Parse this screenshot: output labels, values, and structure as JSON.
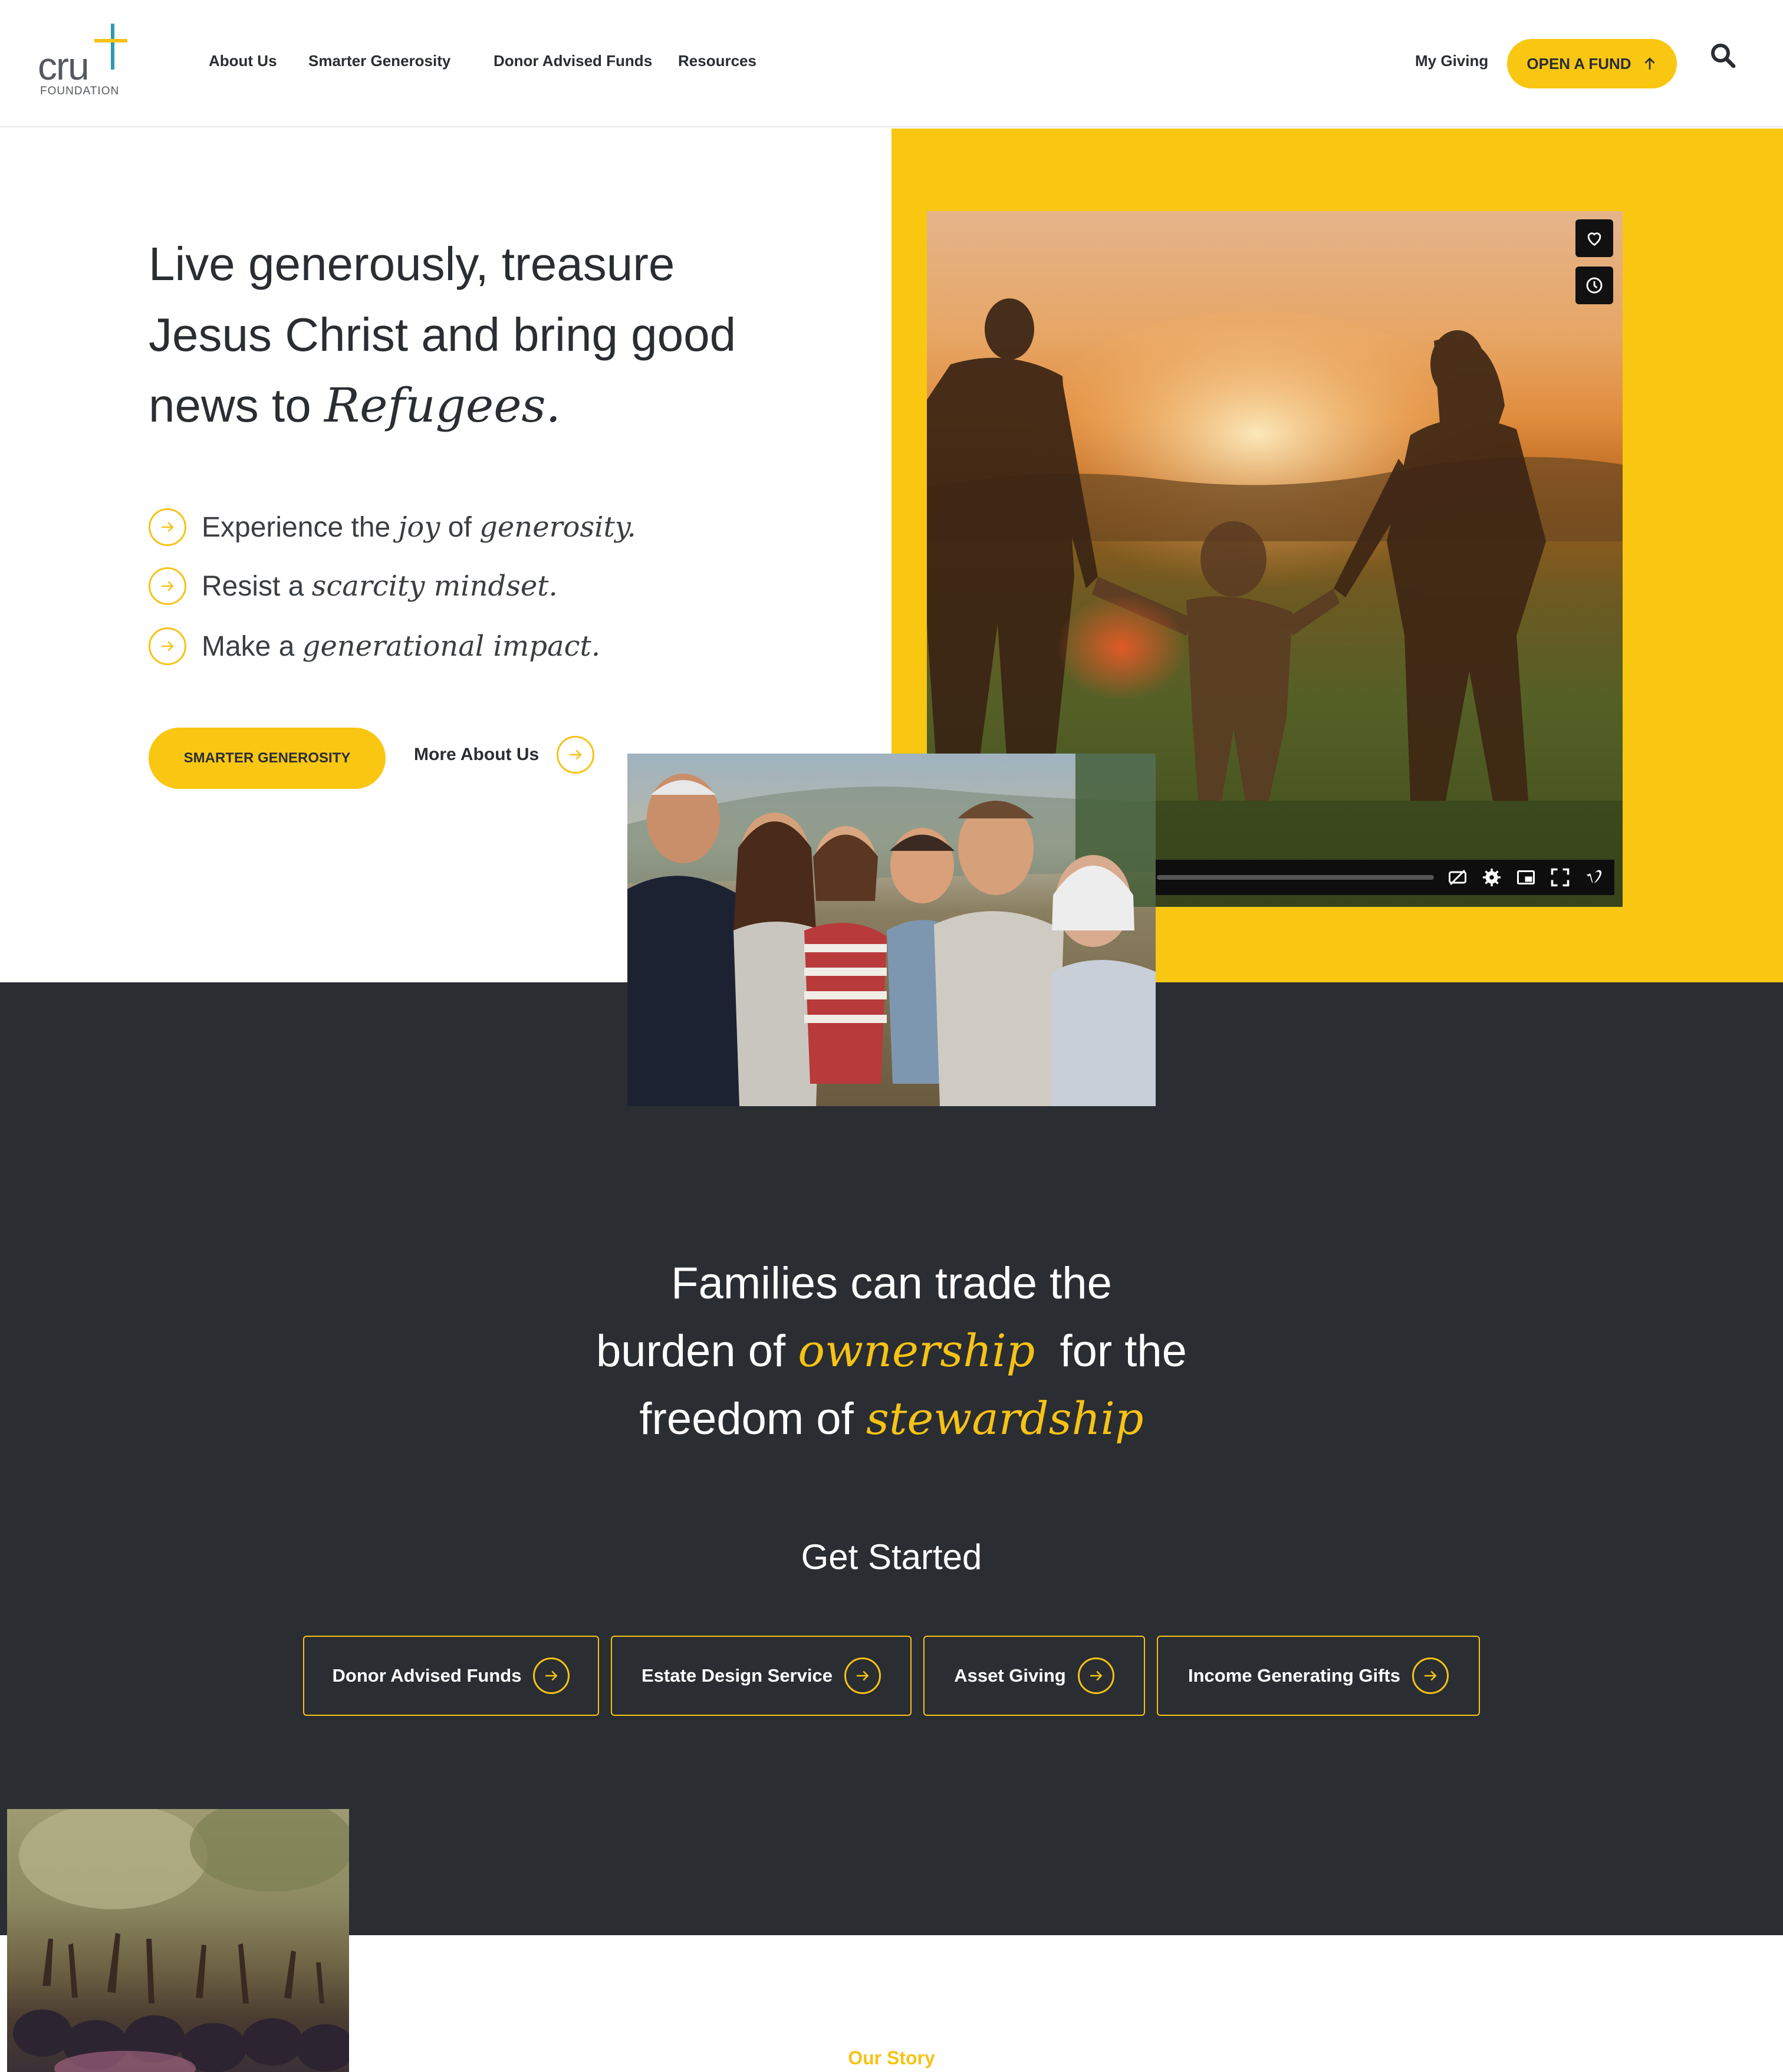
{
  "header": {
    "logo": {
      "text": "cru",
      "sub": "FOUNDATION"
    },
    "nav": [
      "About Us",
      "Smarter Generosity",
      "Donor Advised Funds",
      "Resources"
    ],
    "my_giving": "My Giving",
    "open_fund": "OPEN A FUND"
  },
  "hero": {
    "title_plain": "Live generously, treasure Jesus Christ and bring good news to ",
    "title_italic": "Refugees.",
    "bullets": [
      {
        "prefix": "Experience the ",
        "italic1": "joy",
        "mid": " of ",
        "italic2": "generosity",
        "suffix": "."
      },
      {
        "prefix": "Resist a ",
        "italic1": "scarcity mindset",
        "suffix": "."
      },
      {
        "prefix": "Make a ",
        "italic1": "generational impact",
        "suffix": "."
      }
    ],
    "primary_button": "SMARTER GENEROSITY",
    "secondary_link": "More About Us"
  },
  "video": {
    "controls": [
      "heart-icon",
      "clock-icon",
      "captions-off-icon",
      "settings-icon",
      "pip-icon",
      "fullscreen-icon",
      "vimeo-icon"
    ]
  },
  "quote": {
    "line1": "Families can trade the",
    "line2_a": "burden of ",
    "line2_hl": "ownership",
    "line2_b": "  for the",
    "line3_a": "freedom of ",
    "line3_hl": "stewardship"
  },
  "get_started": {
    "title": "Get Started",
    "buttons": [
      "Donor Advised Funds",
      "Estate Design Service",
      "Asset Giving",
      "Income Generating Gifts"
    ]
  },
  "our_story": {
    "label": "Our Story"
  },
  "colors": {
    "accent": "#f9c712",
    "dark": "#2a2d32",
    "teal": "#2e9cb0"
  }
}
